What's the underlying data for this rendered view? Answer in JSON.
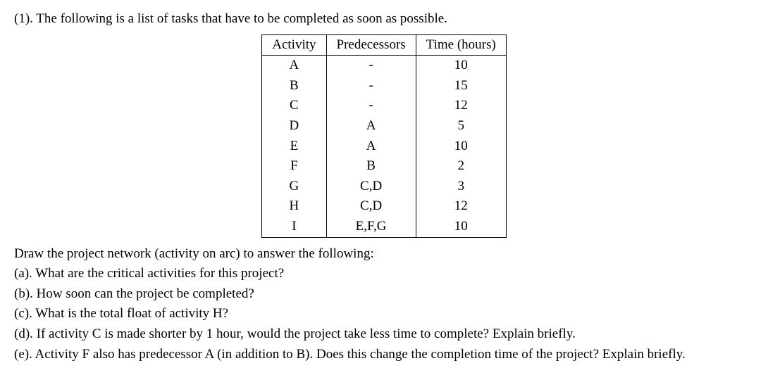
{
  "intro": "(1). The following is a list of tasks that have to be completed as soon as possible.",
  "table": {
    "headers": {
      "activity": "Activity",
      "predecessors": "Predecessors",
      "time": "Time (hours)"
    },
    "rows": [
      {
        "activity": "A",
        "predecessors": "-",
        "time": "10"
      },
      {
        "activity": "B",
        "predecessors": "-",
        "time": "15"
      },
      {
        "activity": "C",
        "predecessors": "-",
        "time": "12"
      },
      {
        "activity": "D",
        "predecessors": "A",
        "time": "5"
      },
      {
        "activity": "E",
        "predecessors": "A",
        "time": "10"
      },
      {
        "activity": "F",
        "predecessors": "B",
        "time": "2"
      },
      {
        "activity": "G",
        "predecessors": "C,D",
        "time": "3"
      },
      {
        "activity": "H",
        "predecessors": "C,D",
        "time": "12"
      },
      {
        "activity": "I",
        "predecessors": "E,F,G",
        "time": "10"
      }
    ]
  },
  "instruction": "Draw the project network (activity on arc) to answer the following:",
  "subquestions": {
    "a": "(a). What are the critical activities for this project?",
    "b": "(b). How soon can the project be completed?",
    "c": "(c). What is the total float of activity H?",
    "d": "(d). If activity C is made shorter by 1 hour, would the project take less time to complete? Explain briefly.",
    "e": "(e). Activity F also has predecessor A (in addition to B). Does this change the completion time of the project? Explain briefly."
  }
}
